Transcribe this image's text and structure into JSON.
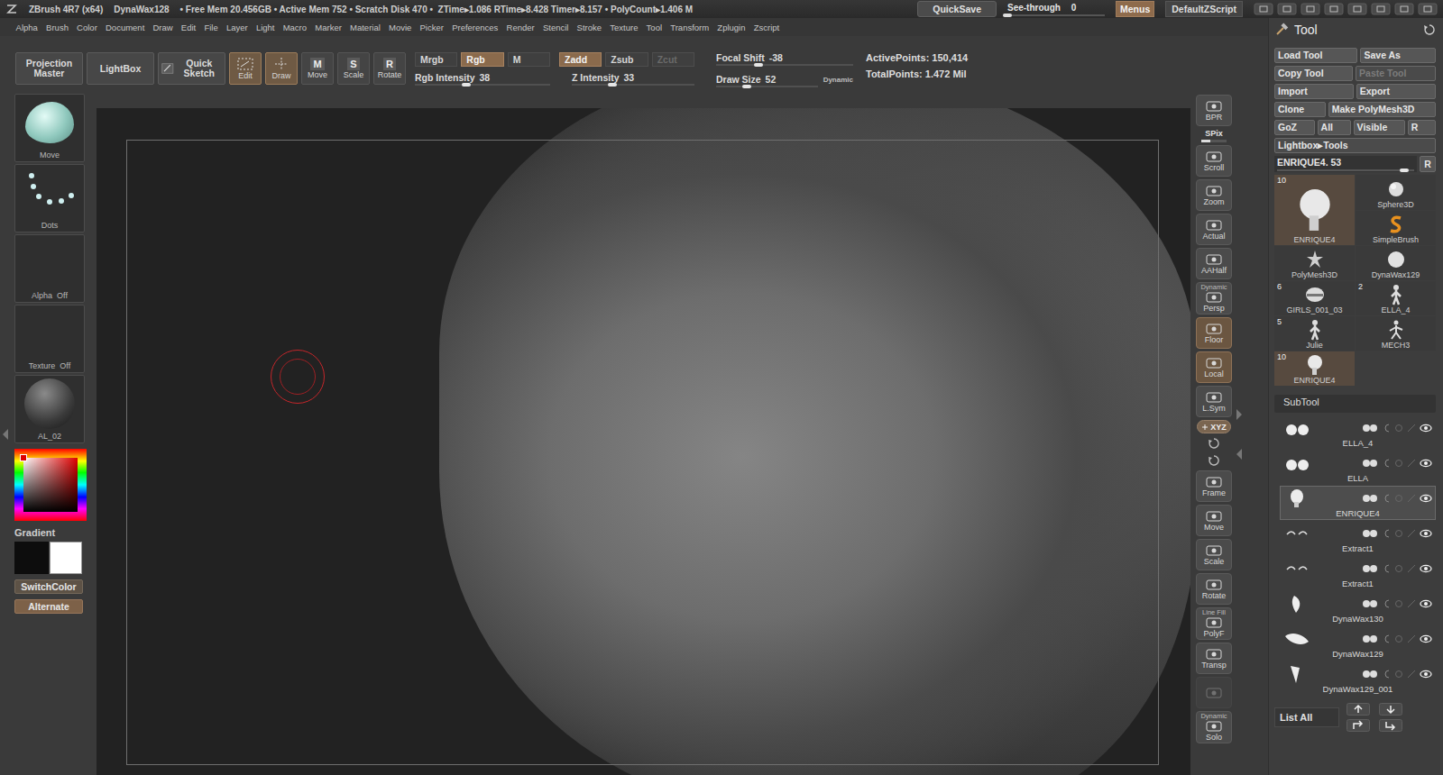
{
  "title_bar": {
    "app": "ZBrush 4R7 (x64)",
    "tool": "DynaWax128",
    "stats": "• Free Mem 20.456GB • Active Mem 752 • Scratch Disk 470 •  ZTime▸1.086 RTime▸8.428 Timer▸8.157 • PolyCount▸1.406 M",
    "quicksave": "QuickSave",
    "see_through": {
      "label": "See-through",
      "value": "0",
      "level": 0
    },
    "menus": {
      "label": "Menus",
      "selected": true
    },
    "script": "DefaultZScript"
  },
  "menu_bar": [
    "Alpha",
    "Brush",
    "Color",
    "Document",
    "Draw",
    "Edit",
    "File",
    "Layer",
    "Light",
    "Macro",
    "Marker",
    "Material",
    "Movie",
    "Picker",
    "Preferences",
    "Render",
    "Stencil",
    "Stroke",
    "Texture",
    "Tool",
    "Transform",
    "Zplugin",
    "Zscript"
  ],
  "shelf": {
    "big_buttons": [
      {
        "label": "Projection Master",
        "kind": "text"
      },
      {
        "label": "LightBox",
        "kind": "text"
      },
      {
        "label": "Quick Sketch",
        "kind": "sketch"
      }
    ],
    "modes": [
      {
        "label": "Edit",
        "kind": "edit",
        "selected": true
      },
      {
        "label": "Draw",
        "kind": "draw",
        "selected": true
      },
      {
        "label": "Move",
        "kind": "letter",
        "glyph": "M",
        "selected": false
      },
      {
        "label": "Scale",
        "kind": "letter",
        "glyph": "S",
        "selected": false
      },
      {
        "label": "Rotate",
        "kind": "letter",
        "glyph": "R",
        "selected": false
      }
    ],
    "color_channels": [
      {
        "label": "Mrgb",
        "selected": false,
        "disabled": false
      },
      {
        "label": "Rgb",
        "selected": true,
        "disabled": false
      },
      {
        "label": "M",
        "selected": false,
        "disabled": false
      }
    ],
    "depth_channels": [
      {
        "label": "Zadd",
        "selected": true,
        "disabled": false
      },
      {
        "label": "Zsub",
        "selected": false,
        "disabled": false
      },
      {
        "label": "Zcut",
        "selected": false,
        "disabled": true
      }
    ],
    "sliders": [
      {
        "label": "Rgb Intensity",
        "value": "38",
        "level": 0.38
      },
      {
        "label": "Z Intensity",
        "value": "33",
        "level": 0.33
      },
      {
        "label": "Focal Shift",
        "value": "-38",
        "level": 0.31
      },
      {
        "label": "Draw Size",
        "value": "52",
        "level": 0.3
      }
    ],
    "dynamic": "Dynamic",
    "stats": [
      {
        "label": "ActivePoints:",
        "value": "150,414"
      },
      {
        "label": "TotalPoints:",
        "value": "1.472 Mil"
      }
    ]
  },
  "left_shelf": {
    "tiles": [
      {
        "label": "Move"
      },
      {
        "label": "Dots"
      },
      {
        "label": "Alpha  Off"
      },
      {
        "label": "Texture  Off"
      },
      {
        "label": "AL_02"
      }
    ],
    "gradient": "Gradient",
    "swatches": [
      {
        "color": "#0d0d0d"
      },
      {
        "color": "#ffffff"
      }
    ],
    "switch": "SwitchColor",
    "alternate": {
      "label": "Alternate",
      "selected": true
    }
  },
  "right_shelf": [
    {
      "label": "BPR",
      "kind": "button",
      "selected": false,
      "disabled": false
    },
    {
      "label": "SPix",
      "kind": "slider",
      "level": 0.35
    },
    {
      "label": "Scroll",
      "kind": "button",
      "selected": false,
      "disabled": false
    },
    {
      "label": "Zoom",
      "kind": "button",
      "selected": false,
      "disabled": false
    },
    {
      "label": "Actual",
      "kind": "button",
      "selected": false,
      "disabled": false
    },
    {
      "label": "AAHalf",
      "kind": "button",
      "selected": false,
      "disabled": false
    },
    {
      "label": "Persp",
      "top": "Dynamic",
      "kind": "button",
      "selected": false,
      "disabled": false
    },
    {
      "label": "Floor",
      "kind": "button",
      "selected": true,
      "disabled": false
    },
    {
      "label": "Local",
      "kind": "button",
      "selected": true,
      "disabled": false
    },
    {
      "label": "L.Sym",
      "kind": "button",
      "selected": false,
      "disabled": false
    },
    {
      "label": "XYZ",
      "kind": "pill",
      "selected": true
    },
    {
      "kind": "mini"
    },
    {
      "kind": "mini"
    },
    {
      "label": "Frame",
      "kind": "button",
      "selected": false,
      "disabled": false
    },
    {
      "label": "Move",
      "kind": "button",
      "selected": false,
      "disabled": false
    },
    {
      "label": "Scale",
      "kind": "button",
      "selected": false,
      "disabled": false
    },
    {
      "label": "Rotate",
      "kind": "button",
      "selected": false,
      "disabled": false
    },
    {
      "label": "PolyF",
      "top": "Line Fill",
      "kind": "button",
      "selected": false,
      "disabled": false
    },
    {
      "label": "Transp",
      "kind": "button",
      "selected": false,
      "disabled": false
    },
    {
      "kind": "button",
      "selected": false,
      "disabled": true
    },
    {
      "label": "Solo",
      "top": "Dynamic",
      "kind": "button",
      "selected": false,
      "disabled": false
    }
  ],
  "tool_panel": {
    "title": "Tool",
    "button_rows": [
      [
        {
          "label": "Load Tool",
          "disabled": false
        },
        {
          "label": "Save As",
          "disabled": false
        }
      ],
      [
        {
          "label": "Copy Tool",
          "disabled": false
        },
        {
          "label": "Paste Tool",
          "disabled": true
        }
      ],
      [
        {
          "label": "Import",
          "disabled": false
        },
        {
          "label": "Export",
          "disabled": false
        }
      ],
      [
        {
          "label": "Clone",
          "disabled": false
        },
        {
          "label": "Make PolyMesh3D",
          "disabled": false
        }
      ],
      [
        {
          "label": "GoZ",
          "disabled": false
        },
        {
          "label": "All",
          "disabled": false
        },
        {
          "label": "Visible",
          "disabled": false
        },
        {
          "label": "R",
          "disabled": false
        }
      ]
    ],
    "lightbox": "Lightbox▸Tools",
    "current": {
      "label": "ENRIQUE4. 53",
      "level": 0.93,
      "reset": "R"
    },
    "tools": [
      {
        "name": "ENRIQUE4",
        "count": "10",
        "kind": "current",
        "selected": true
      },
      {
        "name": "Sphere3D",
        "kind": "tool",
        "selected": false
      },
      {
        "name": "SimpleBrush",
        "kind": "tool",
        "selected": false
      },
      {
        "name": "PolyMesh3D",
        "kind": "tool",
        "selected": false
      },
      {
        "name": "DynaWax129",
        "kind": "tool",
        "selected": false
      },
      {
        "name": "GIRLS_001_03",
        "count": "6",
        "kind": "tool",
        "selected": false
      },
      {
        "name": "ELLA_4",
        "count": "2",
        "kind": "tool",
        "selected": false
      },
      {
        "name": "Julie",
        "count": "5",
        "kind": "tool",
        "selected": false
      },
      {
        "name": "MECH3",
        "kind": "tool",
        "selected": false
      },
      {
        "name": "ENRIQUE4",
        "count": "10",
        "kind": "tool",
        "selected": true
      }
    ],
    "subtool": {
      "title": "SubTool",
      "items": [
        {
          "name": "ELLA_4",
          "visible": true,
          "selected": false
        },
        {
          "name": "ELLA",
          "visible": true,
          "selected": false
        },
        {
          "name": "ENRIQUE4",
          "visible": true,
          "selected": true
        },
        {
          "name": "Extract1",
          "visible": true,
          "selected": false
        },
        {
          "name": "Extract1",
          "visible": true,
          "selected": false
        },
        {
          "name": "DynaWax130",
          "visible": true,
          "selected": false
        },
        {
          "name": "DynaWax129",
          "visible": true,
          "selected": false
        },
        {
          "name": "DynaWax129_001",
          "visible": true,
          "selected": false
        }
      ],
      "list_all": "List All"
    }
  }
}
